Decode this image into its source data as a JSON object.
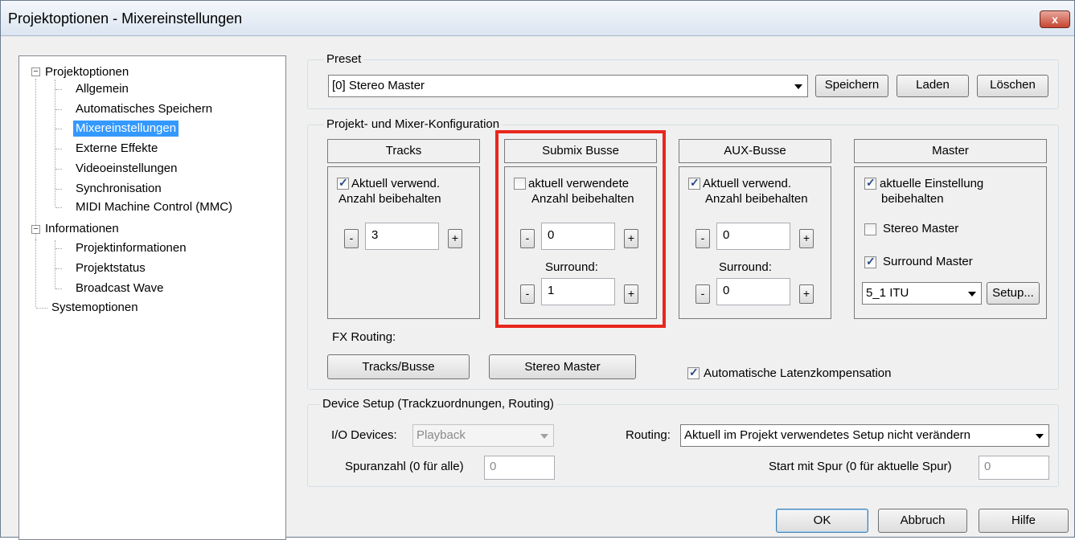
{
  "window": {
    "title": "Projektoptionen - Mixereinstellungen",
    "close_label": "x"
  },
  "tree": {
    "groups": [
      {
        "label": "Projektoptionen",
        "expander": "−"
      },
      {
        "label": "Informationen",
        "expander": "−"
      },
      {
        "label": "Systemoptionen"
      }
    ],
    "items": [
      {
        "label": "Allgemein"
      },
      {
        "label": "Automatisches Speichern"
      },
      {
        "label": "Mixereinstellungen",
        "selected": true
      },
      {
        "label": "Externe Effekte"
      },
      {
        "label": "Videoeinstellungen"
      },
      {
        "label": "Synchronisation"
      },
      {
        "label": "MIDI Machine Control (MMC)"
      },
      {
        "label": "Projektinformationen"
      },
      {
        "label": "Projektstatus"
      },
      {
        "label": "Broadcast Wave"
      }
    ]
  },
  "preset": {
    "group_label": "Preset",
    "value": "[0] Stereo Master",
    "save": "Speichern",
    "load": "Laden",
    "delete": "Löschen"
  },
  "config": {
    "group_label": "Projekt- und Mixer-Konfiguration",
    "tracks": {
      "title": "Tracks",
      "checkbox": "Aktuell verwend.",
      "checkbox2": "Anzahl beibehalten",
      "checked": true,
      "value": "3",
      "minus": "-",
      "plus": "+"
    },
    "submix": {
      "title": "Submix Busse",
      "checkbox": "aktuell verwendete",
      "checkbox2": "Anzahl beibehalten",
      "checked": false,
      "value": "0",
      "surround_label": "Surround:",
      "surround_value": "1",
      "minus": "-",
      "plus": "+"
    },
    "aux": {
      "title": "AUX-Busse",
      "checkbox": "Aktuell verwend.",
      "checkbox2": "Anzahl beibehalten",
      "checked": true,
      "value": "0",
      "surround_label": "Surround:",
      "surround_value": "0",
      "minus": "-",
      "plus": "+"
    },
    "master": {
      "title": "Master",
      "keep": "aktuelle Einstellung",
      "keep2": "beibehalten",
      "keep_checked": true,
      "stereo": "Stereo Master",
      "stereo_checked": false,
      "surround": "Surround Master",
      "surround_checked": true,
      "format": "5_1 ITU",
      "setup": "Setup..."
    }
  },
  "fx": {
    "label": "FX Routing:",
    "tracks_busse": "Tracks/Busse",
    "stereo_master": "Stereo Master",
    "latency": "Automatische Latenzkompensation",
    "latency_checked": true
  },
  "device": {
    "group_label": "Device Setup (Trackzuordnungen, Routing)",
    "io_label": "I/O Devices:",
    "io_value": "Playback",
    "routing_label": "Routing:",
    "routing_value": "Aktuell im Projekt verwendetes Setup nicht verändern",
    "track_count_label": "Spuranzahl (0 für alle)",
    "track_count_value": "0",
    "start_label": "Start mit Spur (0 für aktuelle Spur)",
    "start_value": "0"
  },
  "footer": {
    "ok": "OK",
    "cancel": "Abbruch",
    "help": "Hilfe"
  },
  "colors": {
    "selection": "#3399ff",
    "highlight": "#e8271d"
  }
}
